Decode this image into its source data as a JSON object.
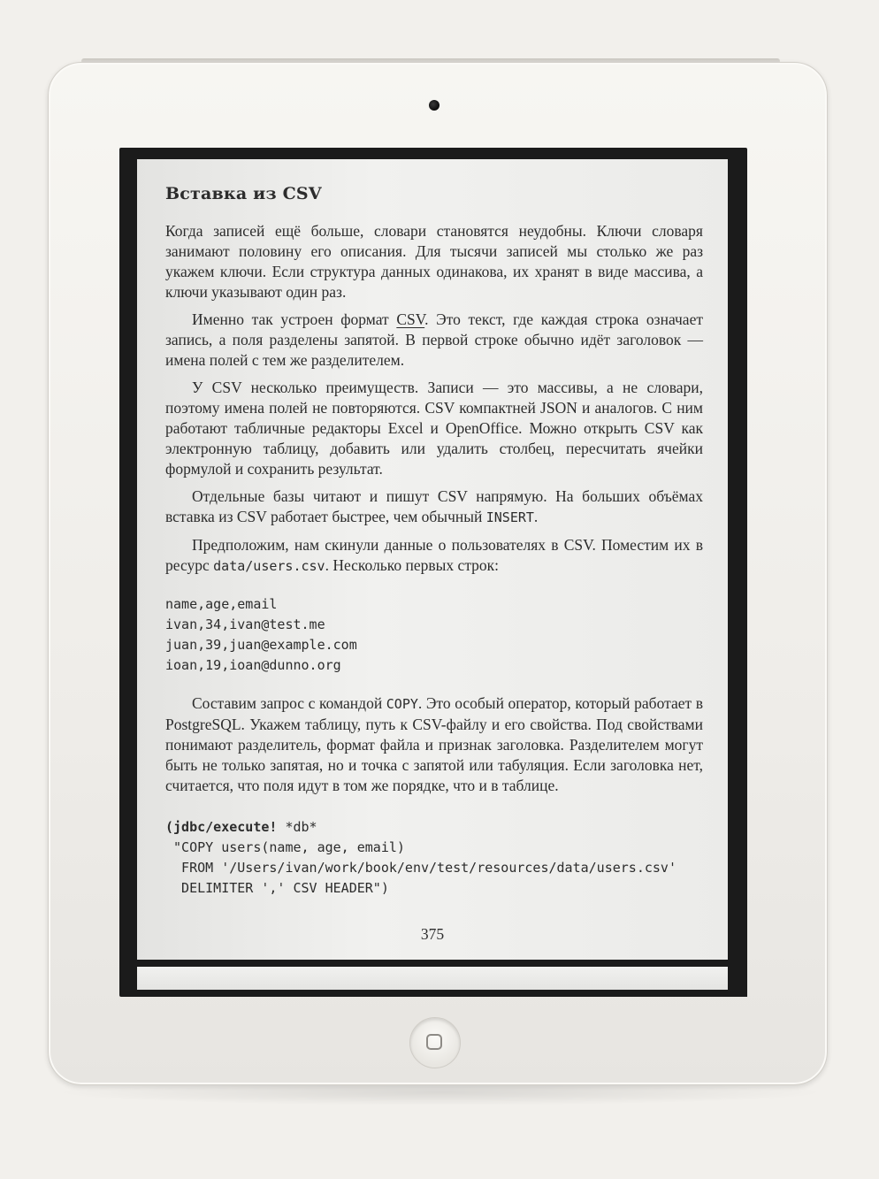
{
  "book": {
    "heading": "Вставка из CSV",
    "paragraphs": [
      {
        "text": "Когда записей ещё больше, словари становятся неудобны. Ключи словаря занимают половину его описания. Для тысячи записей мы столько же раз укажем ключи. Если структура данных одинакова, их хранят в виде массива, а ключи указывают один раз."
      },
      {
        "before": "Именно так устроен формат ",
        "link": "CSV",
        "after": ". Это текст, где каждая строка означает запись, а поля разделены запятой. В первой строке обычно идёт заголовок — имена полей с тем же разделителем."
      },
      {
        "text": "У CSV несколько преимуществ. Записи — это массивы, а не словари, поэтому имена полей не повторяются. CSV компактней JSON и аналогов. С ним работают табличные редакторы Excel и OpenOffice. Можно открыть CSV как электронную таблицу, добавить или удалить столбец, пересчитать ячейки формулой и сохранить результат."
      },
      {
        "before": "Отдельные базы читают и пишут CSV напрямую. На больших объёмах вставка из CSV работает быстрее, чем обычный ",
        "code": "INSERT",
        "after": "."
      },
      {
        "before": "Предположим, нам скинули данные о пользователях в CSV. Поместим их в ресурс ",
        "code": "data/users.csv",
        "after": ". Несколько первых строк:"
      }
    ],
    "csv_lines": [
      "name,age,email",
      "ivan,34,ivan@test.me",
      "juan,39,juan@example.com",
      "ioan,19,ioan@dunno.org"
    ],
    "copy_paragraph": {
      "before": "Составим запрос с командой ",
      "code": "COPY",
      "after": ". Это особый оператор, который работает в PostgreSQL. Укажем таблицу, путь к CSV-файлу и его свойства. Под свойствами понимают разделитель, формат файла и признак заголовка. Разделителем могут быть не только запятая, но и точка с запятой или табуляция. Если заголовка нет, считается, что поля идут в том же порядке, что и в таблице."
    },
    "code_lines": [
      {
        "bold": "(jdbc/execute!",
        "rest": " *db*"
      },
      {
        "bold": "",
        "rest": " \"COPY users(name, age, email)"
      },
      {
        "bold": "",
        "rest": "  FROM '/Users/ivan/work/book/env/test/resources/data/users.csv'"
      },
      {
        "bold": "",
        "rest": "  DELIMITER ',' CSV HEADER\")"
      }
    ],
    "page_number": "375"
  }
}
